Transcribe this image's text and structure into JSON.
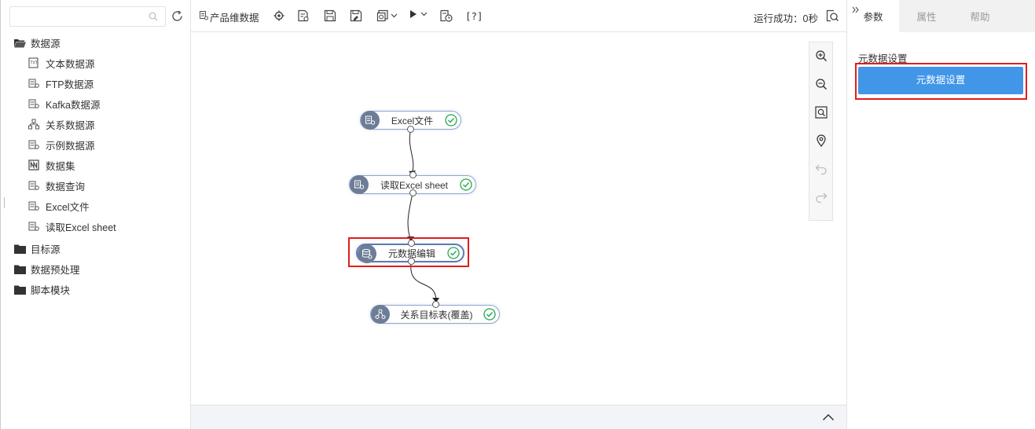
{
  "search": {
    "placeholder": "",
    "value": ""
  },
  "tree": {
    "root": {
      "label": "数据源",
      "icon": "folder-open-icon"
    },
    "children": [
      {
        "label": "文本数据源",
        "icon": "text-file-icon"
      },
      {
        "label": "FTP数据源",
        "icon": "datasource-icon"
      },
      {
        "label": "Kafka数据源",
        "icon": "datasource-icon"
      },
      {
        "label": "关系数据源",
        "icon": "relation-icon"
      },
      {
        "label": "示例数据源",
        "icon": "datasource-icon"
      },
      {
        "label": "数据集",
        "icon": "dataset-icon"
      },
      {
        "label": "数据查询",
        "icon": "datasource-icon"
      },
      {
        "label": "Excel文件",
        "icon": "datasource-icon"
      },
      {
        "label": "读取Excel sheet",
        "icon": "datasource-icon"
      }
    ],
    "folders": [
      {
        "label": "目标源",
        "icon": "folder-icon"
      },
      {
        "label": "数据预处理",
        "icon": "folder-icon"
      },
      {
        "label": "脚本模块",
        "icon": "folder-icon"
      }
    ]
  },
  "toolbar": {
    "title": "产品维数据",
    "help_label": "[?]",
    "status": "运行成功：0秒"
  },
  "flow": {
    "nodes": [
      {
        "label": "Excel文件",
        "icon": "datasource-icon",
        "status": "success"
      },
      {
        "label": "读取Excel sheet",
        "icon": "datasource-icon",
        "status": "success"
      },
      {
        "label": "元数据编辑",
        "icon": "metadata-icon",
        "status": "success",
        "selected": true
      },
      {
        "label": "关系目标表(覆盖)",
        "icon": "relation-target-icon",
        "status": "success"
      }
    ]
  },
  "right_panel": {
    "tabs": [
      {
        "label": "参数",
        "active": true
      },
      {
        "label": "属性",
        "active": false
      },
      {
        "label": "帮助",
        "active": false
      }
    ],
    "section_title": "元数据设置",
    "button_label": "元数据设置"
  },
  "colors": {
    "accent": "#4196e8",
    "highlight": "#e11d1d",
    "success": "#22a94b",
    "node_icon_bg": "#6e7d96"
  }
}
